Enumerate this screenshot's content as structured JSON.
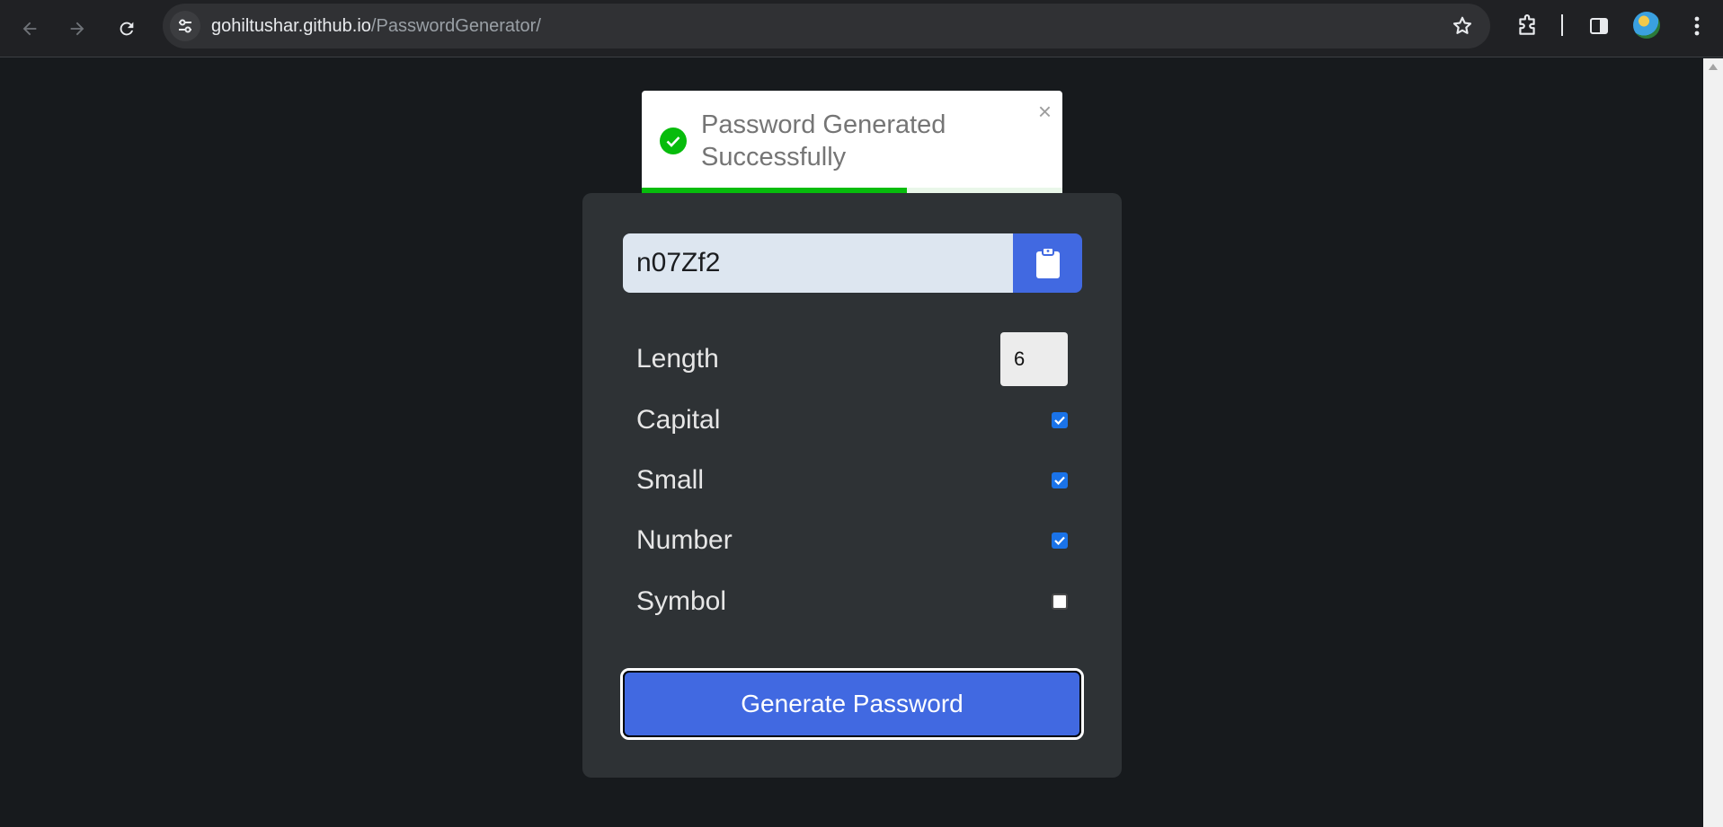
{
  "browser": {
    "url_host": "gohiltushar.github.io",
    "url_path": "/PasswordGenerator/",
    "icons": [
      "back-arrow-icon",
      "forward-arrow-icon",
      "reload-icon",
      "site-settings-icon",
      "bookmark-star-icon",
      "extensions-icon",
      "side-panel-icon",
      "profile-avatar",
      "menu-dots-icon"
    ]
  },
  "toast": {
    "message": "Password Generated Successfully",
    "close": "×",
    "progress": 0.63,
    "color": "#07bc0c"
  },
  "generator": {
    "password": "n07Zf2",
    "copy_icon": "clipboard-icon",
    "options": {
      "length": {
        "label": "Length",
        "value": "6"
      },
      "capital": {
        "label": "Capital",
        "checked": true
      },
      "small": {
        "label": "Small",
        "checked": true
      },
      "number": {
        "label": "Number",
        "checked": true
      },
      "symbol": {
        "label": "Symbol",
        "checked": false
      }
    },
    "generate_label": "Generate Password",
    "accent": "#4169e1"
  }
}
